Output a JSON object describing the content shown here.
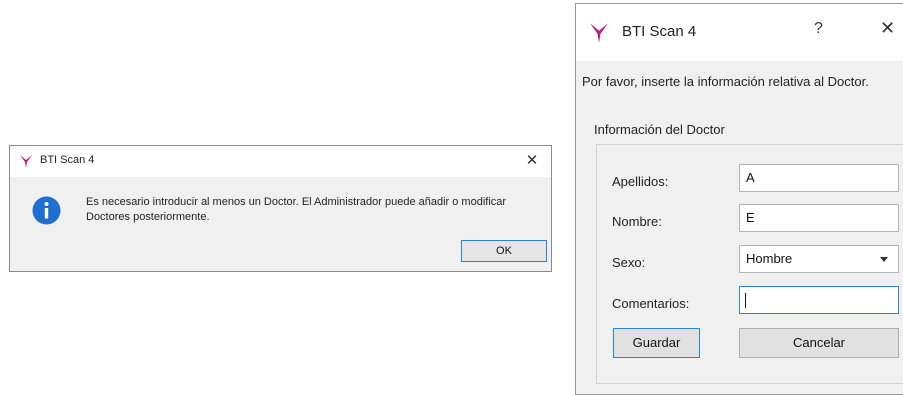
{
  "message_box": {
    "title": "BTI Scan 4",
    "close_glyph": "✕",
    "icon": "info-icon",
    "message": "Es necesario introducir al menos un Doctor. El Administrador puede añadir o modificar Doctores posteriormente.",
    "ok_label": "OK"
  },
  "dialog": {
    "title": "BTI Scan 4",
    "help_glyph": "?",
    "close_glyph": "✕",
    "prompt": "Por favor, inserte la información relativa al Doctor.",
    "section_label": "Información del Doctor",
    "fields": {
      "apellidos": {
        "label": "Apellidos:",
        "value": "A"
      },
      "nombre": {
        "label": "Nombre:",
        "value": "E"
      },
      "sexo": {
        "label": "Sexo:",
        "value": "Hombre"
      },
      "comentarios": {
        "label": "Comentarios:",
        "value": ""
      }
    },
    "save_label": "Guardar",
    "cancel_label": "Cancelar"
  },
  "colors": {
    "accent": "#2e82d9",
    "logo_magenta": "#c2187a",
    "info_blue": "#1e6fd0"
  }
}
